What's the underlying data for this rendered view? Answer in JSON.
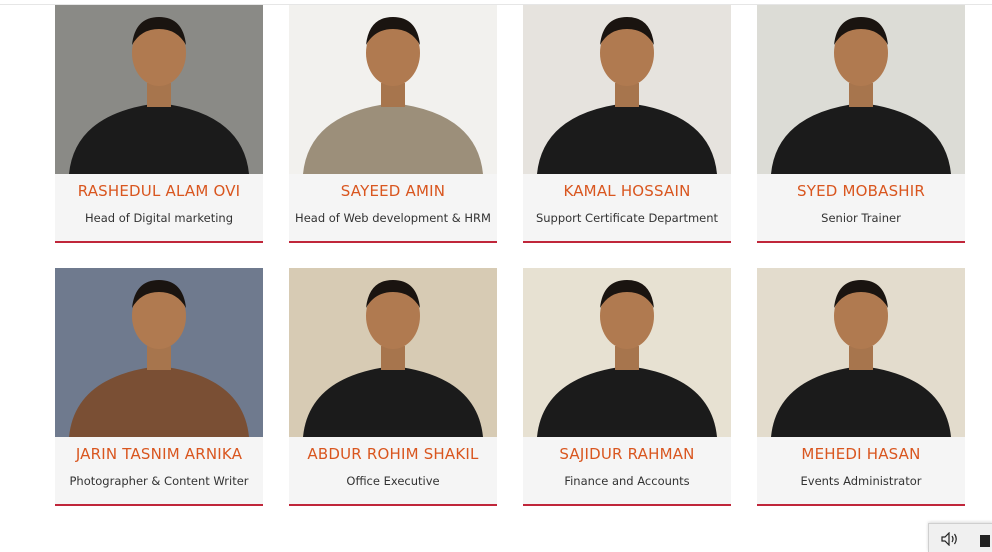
{
  "team": [
    {
      "name": "RASHEDUL ALAM OVI",
      "role": "Head of Digital marketing",
      "bg": "#8a8a86",
      "shirt": "#1b1b1b"
    },
    {
      "name": "SAYEED AMIN",
      "role": "Head of Web development & HRM",
      "bg": "#f2f1ee",
      "shirt": "#9c8f7a"
    },
    {
      "name": "KAMAL HOSSAIN",
      "role": "Support Certificate Department",
      "bg": "#e6e3de",
      "shirt": "#1b1b1b"
    },
    {
      "name": "SYED MOBASHIR",
      "role": "Senior Trainer",
      "bg": "#dcdcd6",
      "shirt": "#1b1b1b"
    },
    {
      "name": "JARIN TASNIM ARNIKA",
      "role": "Photographer & Content Writer",
      "bg": "#6f7a8e",
      "shirt": "#7a4f34"
    },
    {
      "name": "ABDUR ROHIM SHAKIL",
      "role": "Office Executive",
      "bg": "#d7cbb4",
      "shirt": "#1b1b1b"
    },
    {
      "name": "SAJIDUR RAHMAN",
      "role": "Finance and Accounts",
      "bg": "#e7e1d2",
      "shirt": "#1b1b1b"
    },
    {
      "name": "MEHEDI HASAN",
      "role": "Events Administrator",
      "bg": "#e3dccd",
      "shirt": "#1b1b1b"
    }
  ],
  "colors": {
    "name": "#d9561f",
    "underline": "#c0263a",
    "card": "#f5f5f5"
  },
  "tray": {
    "icons": [
      "speaker-icon",
      "show-desktop-icon"
    ]
  }
}
